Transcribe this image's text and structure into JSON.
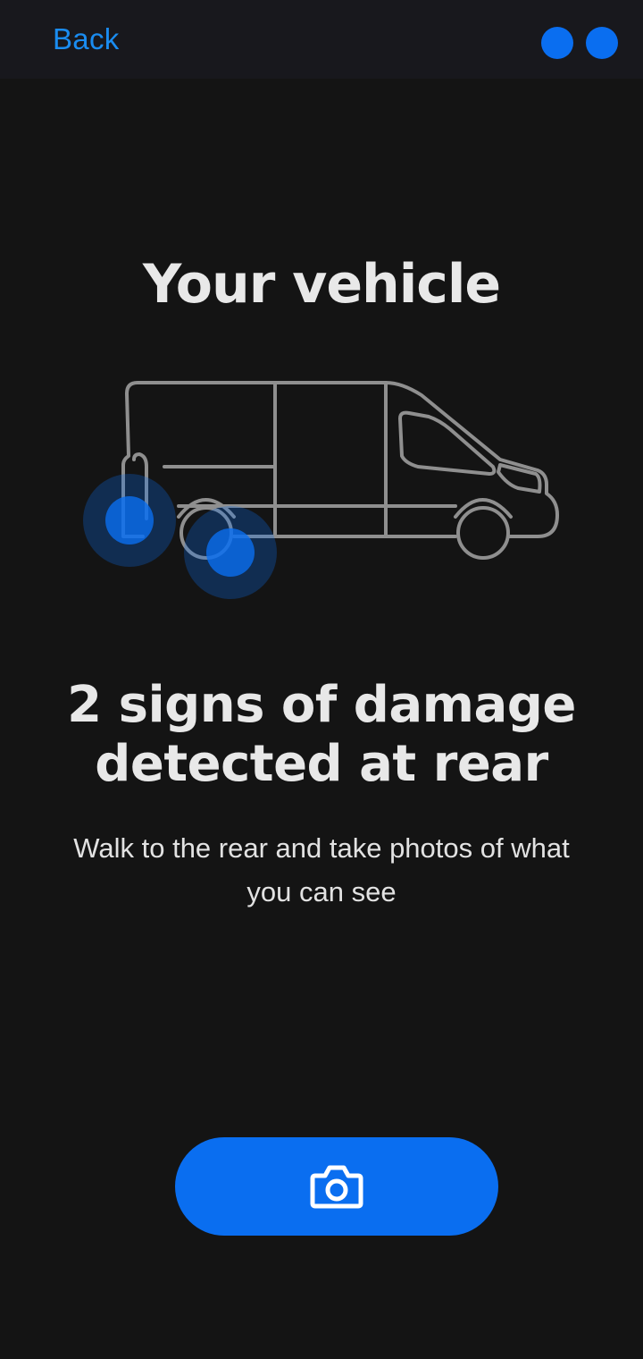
{
  "header": {
    "back_label": "Back"
  },
  "main": {
    "title": "Your vehicle",
    "headline": "2 signs of damage detected at rear",
    "instruction": "Walk to the rear and take photos of what you can see"
  },
  "actions": {
    "camera_button_icon": "camera-icon"
  },
  "illustration": {
    "vehicle": "van-outline",
    "damage_marker_count": 2
  },
  "colors": {
    "accent": "#0a6ef0",
    "link": "#1a8cf0",
    "background": "#141414",
    "header_background": "#18181d",
    "text": "#e8e8e8",
    "vehicle_outline": "#8f8f8f"
  }
}
